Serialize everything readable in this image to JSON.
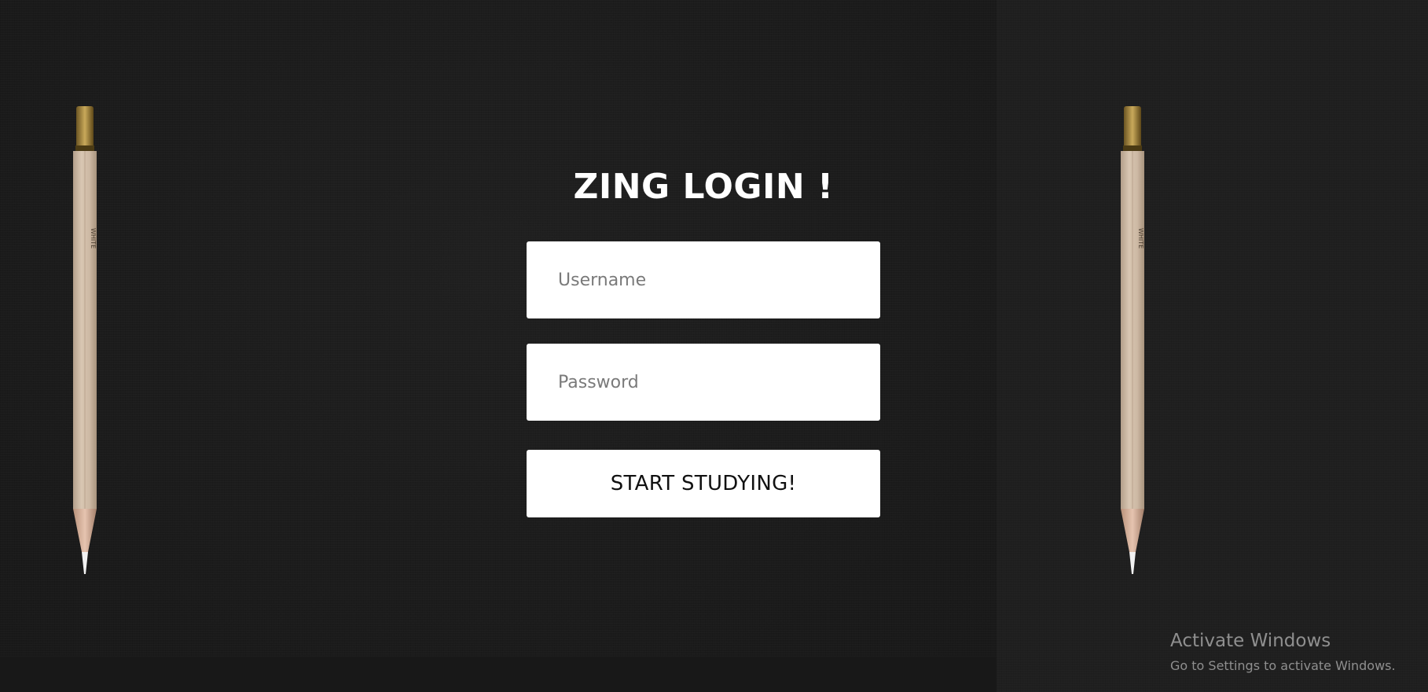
{
  "login": {
    "title": "ZING LOGIN !",
    "username_placeholder": "Username",
    "password_placeholder": "Password",
    "submit_label": "START STUDYING!"
  },
  "watermark": {
    "title": "Activate Windows",
    "subtitle": "Go to Settings to activate Windows."
  },
  "decor": {
    "left_image": "pencil",
    "right_image": "pencil",
    "pencil_imprint": "WHITE"
  },
  "colors": {
    "background": "#1d1d1d",
    "field_bg": "#ffffff",
    "title_text": "#ffffff",
    "watermark_text": "#8f8f8f"
  }
}
